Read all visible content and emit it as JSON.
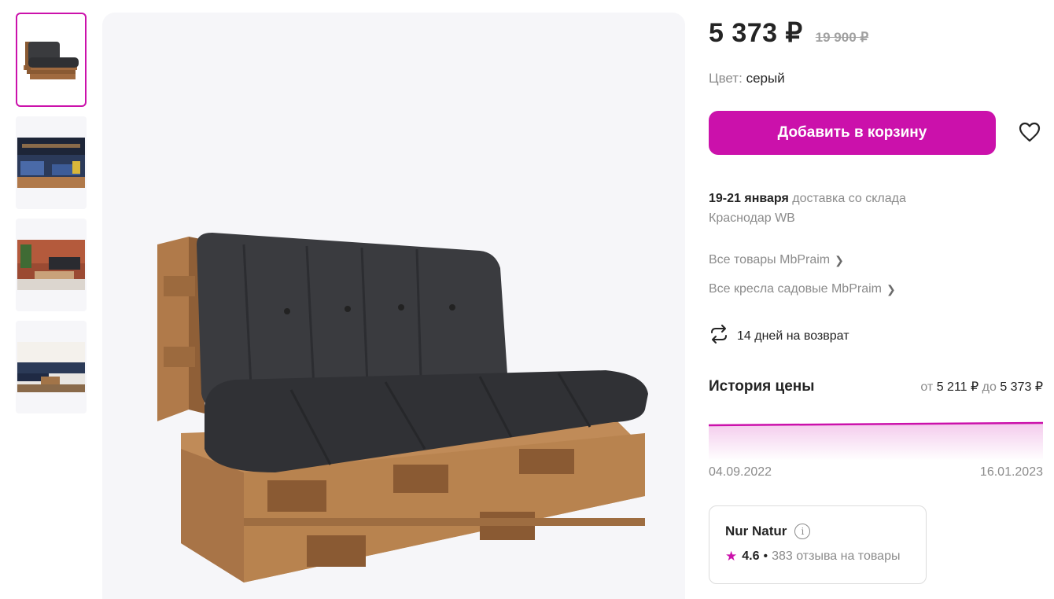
{
  "product": {
    "price": "5 373 ₽",
    "old_price": "19 900 ₽",
    "color_label": "Цвет:",
    "color_value": "серый",
    "add_to_cart_label": "Добавить в корзину"
  },
  "delivery": {
    "date": "19-21 января",
    "text": "доставка со склада Краснодар WB"
  },
  "links": {
    "all_brand_items": "Все товары MbPraim",
    "all_garden_chairs": "Все кресла садовые MbPraim"
  },
  "returns": {
    "label": "14 дней на возврат"
  },
  "price_history": {
    "title": "История цены",
    "from_label": "от",
    "min_price": "5 211 ₽",
    "to_label": "до",
    "max_price": "5 373 ₽",
    "start_date": "04.09.2022",
    "end_date": "16.01.2023"
  },
  "seller": {
    "name": "Nur Natur",
    "rating": "4.6",
    "reviews": "383 отзыва на товары"
  },
  "colors": {
    "accent": "#cb11ab",
    "text": "#242424",
    "muted": "#8b8b8b",
    "gallery_bg": "#f6f6f9"
  },
  "icons": {
    "favorite": "heart-outline-icon",
    "return": "refresh-arrows-icon",
    "info": "info-circle-icon",
    "rating": "star-icon",
    "link_arrow": "chevron-right-icon"
  }
}
